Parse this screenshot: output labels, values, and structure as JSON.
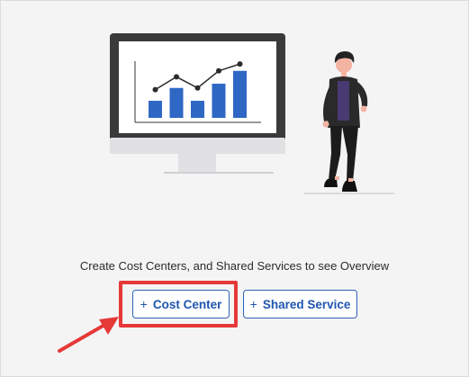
{
  "empty_state": {
    "message": "Create Cost Centers, and Shared Services to see Overview"
  },
  "actions": {
    "cost_center": {
      "icon": "+",
      "label": "Cost Center"
    },
    "shared_service": {
      "icon": "+",
      "label": "Shared Service"
    }
  },
  "illustration": {
    "chart_bar_values": [
      2,
      3.5,
      2,
      4,
      5.5
    ],
    "chart_line_values": [
      3.3,
      4.8,
      3.5,
      5.5,
      6.3
    ]
  },
  "colors": {
    "accent": "#2f64b7",
    "highlight": "#e53938",
    "bar": "#2f67c4",
    "monitor": "#3a3a3a"
  }
}
